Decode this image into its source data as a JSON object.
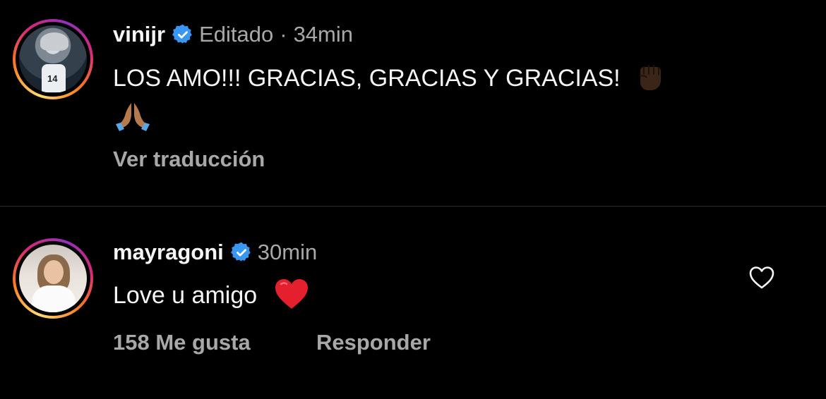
{
  "comments": [
    {
      "username": "vinijr",
      "edited_label": "Editado",
      "time": "34min",
      "text": "LOS AMO!!! GRACIAS, GRACIAS Y GRACIAS!",
      "emojis": [
        "raised-fist-dark-skin",
        "folded-hands"
      ],
      "action_label": "Ver traducción"
    },
    {
      "username": "mayragoni",
      "time": "30min",
      "text": "Love u amigo",
      "emojis": [
        "red-heart"
      ],
      "likes_label": "158 Me gusta",
      "reply_label": "Responder"
    }
  ],
  "colors": {
    "background": "#000000",
    "primary_text": "#f5f5f5",
    "secondary_text": "#a8a8a8",
    "verified_badge": "#3897f0",
    "divider": "#2a2a2a"
  },
  "icons": {
    "verified": "verified-badge-icon",
    "like": "heart-outline-icon"
  },
  "separator": "·"
}
